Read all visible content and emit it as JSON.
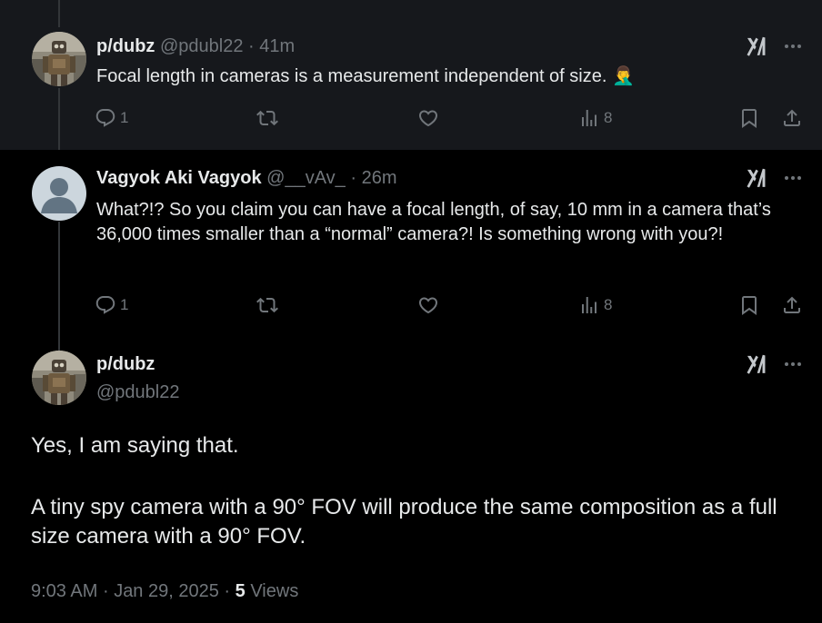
{
  "posts": [
    {
      "name": "p/dubz",
      "handle": "@pdubl22",
      "time": "41m",
      "text": "Focal length in cameras is a measurement independent of size. 🤦‍♂️",
      "replies": "1",
      "views": "8"
    },
    {
      "name": "Vagyok Aki Vagyok",
      "handle": "@__vAv_",
      "time": "26m",
      "text": "What?!? So you claim you can have a focal length, of say, 10 mm in a camera that’s 36,000 times smaller than a “normal” camera?! Is something wrong with you?!",
      "replies": "1",
      "views": "8"
    }
  ],
  "main": {
    "name": "p/dubz",
    "handle": "@pdubl22",
    "paragraph1": "Yes, I am saying that.",
    "paragraph2": "A tiny spy camera with a 90° FOV will produce the same composition as a full size camera with a 90° FOV.",
    "time": "9:03 AM",
    "date": "Jan 29, 2025",
    "views_count": "5",
    "views_label": "Views"
  },
  "icons": {
    "reply": "reply-icon",
    "repost": "repost-icon",
    "like": "like-icon",
    "views": "views-icon",
    "bookmark": "bookmark-icon",
    "share": "share-icon",
    "grok": "grok-icon",
    "more": "more-icon"
  },
  "colors": {
    "background": "#000000",
    "highlight_background": "#16181c",
    "text_primary": "#e7e9ea",
    "text_secondary": "#71767b",
    "thread_line": "#333639"
  }
}
